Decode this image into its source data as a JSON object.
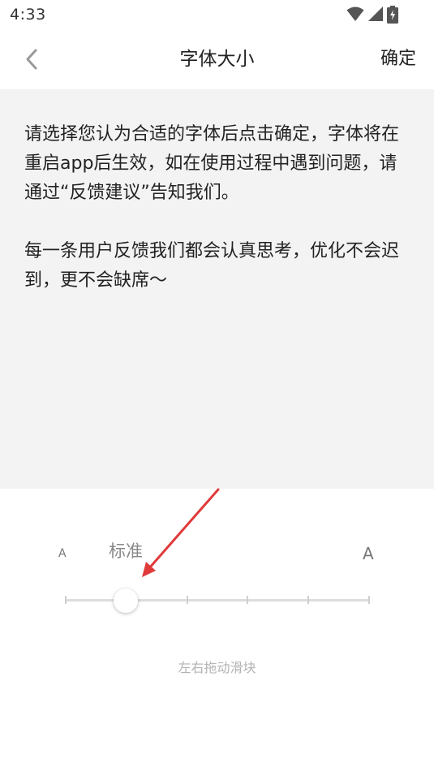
{
  "status_bar": {
    "time": "4:33",
    "icons": [
      "wifi-icon",
      "signal-icon",
      "battery-charging-icon"
    ]
  },
  "nav": {
    "back_icon": "chevron-left-icon",
    "title": "字体大小",
    "confirm_label": "确定"
  },
  "preview": {
    "paragraph1": "请选择您认为合适的字体后点击确定，字体将在重启app后生效，如在使用过程中遇到问题，请通过“反馈建议”告知我们。",
    "paragraph2": "每一条用户反馈我们都会认真思考，优化不会迟到，更不会缺席～"
  },
  "font_size_control": {
    "small_label": "A",
    "large_label": "A",
    "current_level_label": "标准",
    "level_count": 6,
    "selected_level": 2,
    "hint": "左右拖动滑块"
  },
  "colors": {
    "preview_background": "#f3f3f3",
    "annotation_arrow": "#e03a3a"
  }
}
